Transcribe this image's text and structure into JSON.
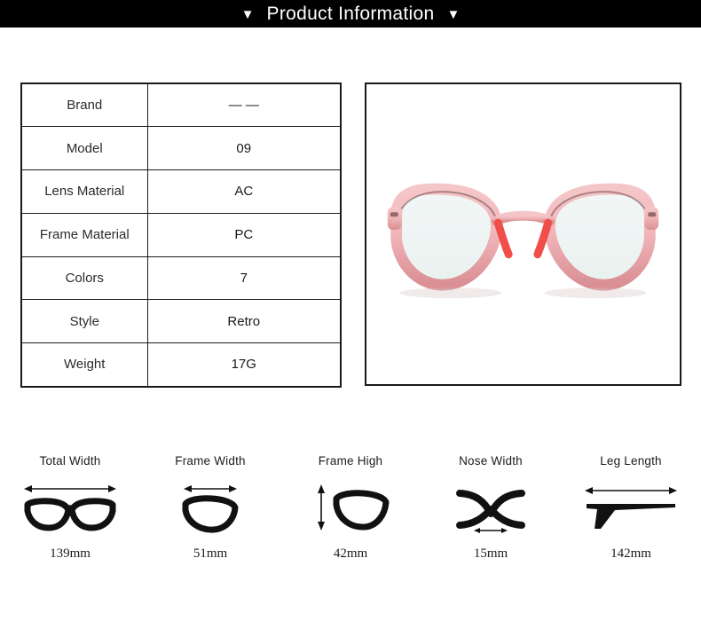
{
  "header": {
    "title": "Product Information",
    "left_marker": "▼",
    "right_marker": "▼",
    "background_color": "#000000",
    "text_color": "#ffffff"
  },
  "spec_table": {
    "rows": [
      {
        "key": "Brand",
        "value": "— —"
      },
      {
        "key": "Model",
        "value": "09"
      },
      {
        "key": "Lens Material",
        "value": "AC"
      },
      {
        "key": "Frame Material",
        "value": "PC"
      },
      {
        "key": "Colors",
        "value": "7"
      },
      {
        "key": "Style",
        "value": "Retro"
      },
      {
        "key": "Weight",
        "value": "17G"
      }
    ]
  },
  "product_photo": {
    "alt": "Round translucent pink eyeglasses frame, front view",
    "frame_color": "#f0b9bd",
    "accent_color": "#ef4f48",
    "lens_color": "#eef4f3",
    "background_color": "#ffffff"
  },
  "measurements": [
    {
      "label": "Total Width",
      "value": "139mm",
      "icon": "full-glasses-width-icon",
      "arrow": "horizontal"
    },
    {
      "label": "Frame Width",
      "value": "51mm",
      "icon": "single-lens-width-icon",
      "arrow": "horizontal"
    },
    {
      "label": "Frame High",
      "value": "42mm",
      "icon": "single-lens-height-icon",
      "arrow": "vertical"
    },
    {
      "label": "Nose Width",
      "value": "15mm",
      "icon": "nose-bridge-icon",
      "arrow": "horizontal"
    },
    {
      "label": "Leg Length",
      "value": "142mm",
      "icon": "temple-arm-icon",
      "arrow": "horizontal"
    }
  ]
}
